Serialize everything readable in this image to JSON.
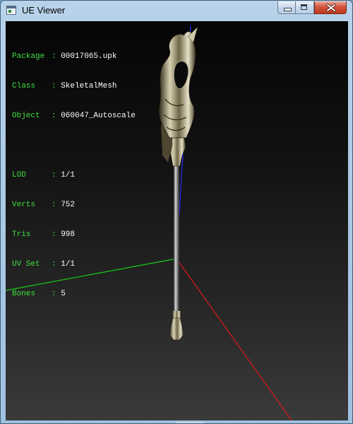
{
  "window": {
    "title": "UE Viewer",
    "icon": "ue-viewer-app-icon",
    "controls": [
      "minimize-icon",
      "maximize-icon",
      "close-icon"
    ]
  },
  "info": {
    "package": {
      "label": "Package",
      "value": "00017065.upk"
    },
    "class": {
      "label": "Class",
      "value": "SkeletalMesh"
    },
    "object": {
      "label": "Object",
      "value": "060047_Autoscale"
    },
    "lod": {
      "label": "LOD",
      "value": "1/1"
    },
    "verts": {
      "label": "Verts",
      "value": "752"
    },
    "tris": {
      "label": "Tris",
      "value": "998"
    },
    "uvset": {
      "label": "UV Set",
      "value": "1/1"
    },
    "bones": {
      "label": "Bones",
      "value": "5"
    }
  },
  "scene": {
    "background": "#1a1a1a",
    "axis_colors": {
      "x": "#e01818",
      "y": "#18d018",
      "z": "#2a2aff"
    },
    "mesh": "ornate-staff"
  }
}
